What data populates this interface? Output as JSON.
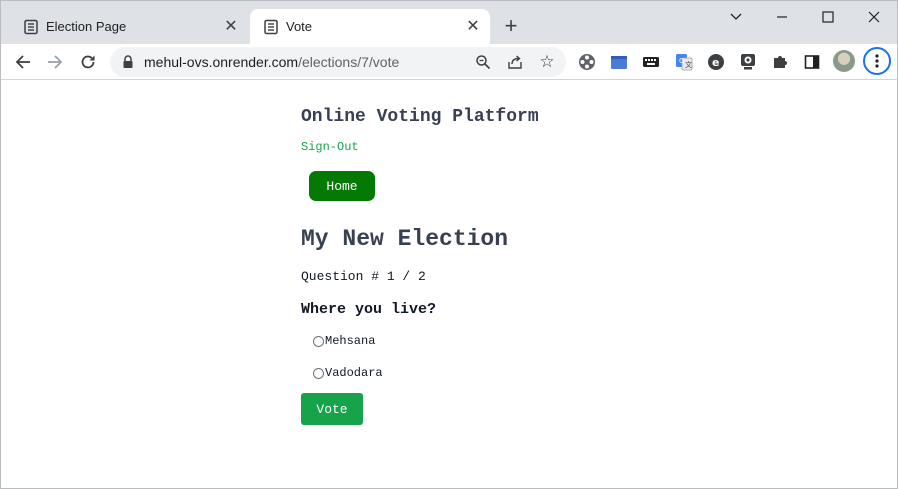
{
  "browser": {
    "tabs": [
      {
        "title": "Election Page",
        "active": false
      },
      {
        "title": "Vote",
        "active": true
      }
    ],
    "url_host": "mehul-ovs.onrender.com",
    "url_path": "/elections/7/vote",
    "extensions": [
      "film-reel-icon",
      "blue-folder-icon",
      "keyboard-icon",
      "translate-icon",
      "e-circle-icon",
      "webcam-icon",
      "puzzle-icon",
      "sidepanel-icon"
    ]
  },
  "page": {
    "app_title": "Online Voting Platform",
    "signout_label": "Sign-Out",
    "home_label": "Home",
    "election_title": "My New Election",
    "question_counter": "Question # 1 / 2",
    "question_text": "Where you live?",
    "options": [
      "Mehsana",
      "Vadodara"
    ],
    "vote_label": "Vote"
  },
  "colors": {
    "home_button": "#047a04",
    "vote_button": "#16a34a",
    "signout_link": "#16a34a",
    "focus_ring": "#1a73e8"
  }
}
